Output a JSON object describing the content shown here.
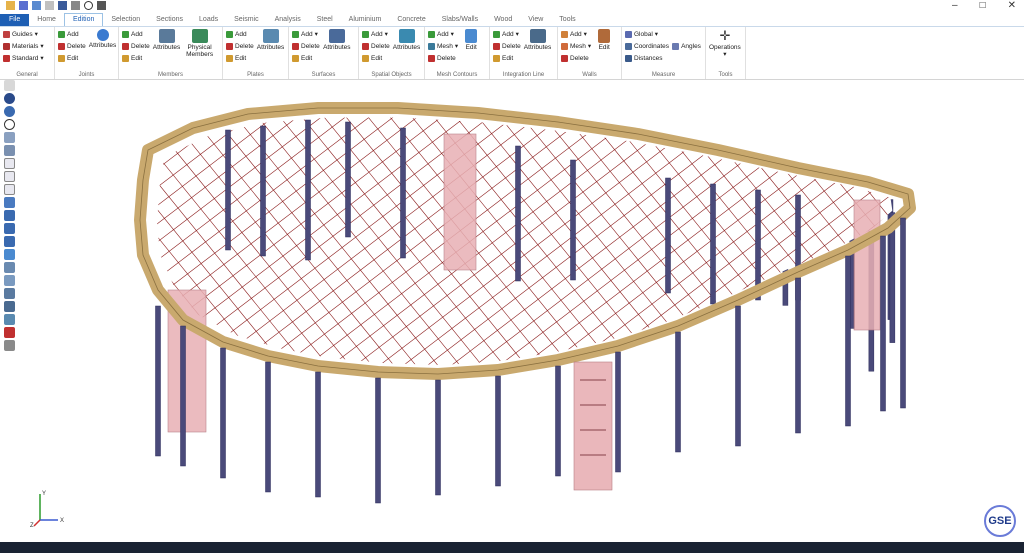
{
  "tabs": [
    {
      "label": "File",
      "state": "file"
    },
    {
      "label": "Home",
      "state": ""
    },
    {
      "label": "Edition",
      "state": "active"
    },
    {
      "label": "Selection",
      "state": ""
    },
    {
      "label": "Sections",
      "state": ""
    },
    {
      "label": "Loads",
      "state": ""
    },
    {
      "label": "Seismic",
      "state": ""
    },
    {
      "label": "Analysis",
      "state": ""
    },
    {
      "label": "Steel",
      "state": ""
    },
    {
      "label": "Aluminium",
      "state": ""
    },
    {
      "label": "Concrete",
      "state": ""
    },
    {
      "label": "Slabs/Walls",
      "state": ""
    },
    {
      "label": "Wood",
      "state": ""
    },
    {
      "label": "View",
      "state": ""
    },
    {
      "label": "Tools",
      "state": ""
    }
  ],
  "window_controls": {
    "min": "–",
    "max": "□",
    "close": "✕"
  },
  "ribbon": {
    "general": {
      "label": "General",
      "guides": "Guides",
      "materials": "Materials",
      "standard": "Standard"
    },
    "joints": {
      "label": "Joints",
      "add": "Add",
      "delete": "Delete",
      "edit": "Edit",
      "attributes": "Attributes"
    },
    "members": {
      "label": "Members",
      "add": "Add",
      "delete": "Delete",
      "edit": "Edit",
      "attributes": "Attributes",
      "physical_members": "Physical Members"
    },
    "plates": {
      "label": "Plates",
      "add": "Add",
      "delete": "Delete",
      "edit": "Edit",
      "attributes": "Attributes"
    },
    "surfaces": {
      "label": "Surfaces",
      "add": "Add",
      "delete": "Delete",
      "edit": "Edit",
      "attributes": "Attributes"
    },
    "spatial_objects": {
      "label": "Spatial Objects",
      "add": "Add",
      "delete": "Delete",
      "edit": "Edit",
      "attributes": "Attributes"
    },
    "mesh_contours": {
      "label": "Mesh Contours",
      "add": "Add",
      "mesh": "Mesh",
      "delete": "Delete",
      "edit": "Edit"
    },
    "integration_line": {
      "label": "Integration Line",
      "add": "Add",
      "delete": "Delete",
      "edit": "Edit",
      "attributes": "Attributes"
    },
    "walls": {
      "label": "Walls",
      "add": "Add",
      "mesh": "Mesh",
      "delete": "Delete",
      "edit": "Edit"
    },
    "measure": {
      "label": "Measure",
      "global": "Global",
      "coordinates": "Coordinates",
      "distances": "Distances",
      "angles": "Angles"
    },
    "tools": {
      "label": "Tools",
      "operations": "Operations"
    }
  },
  "axes": {
    "x": "X",
    "y": "Y",
    "z": "Z"
  },
  "logo": {
    "text": "GSE"
  },
  "colors": {
    "accent": "#1e5fb4",
    "slab_edge": "#c9a96e",
    "column": "#4a4a7a",
    "wall": "#e8b0b4",
    "mesh": "#8a1a1a"
  }
}
